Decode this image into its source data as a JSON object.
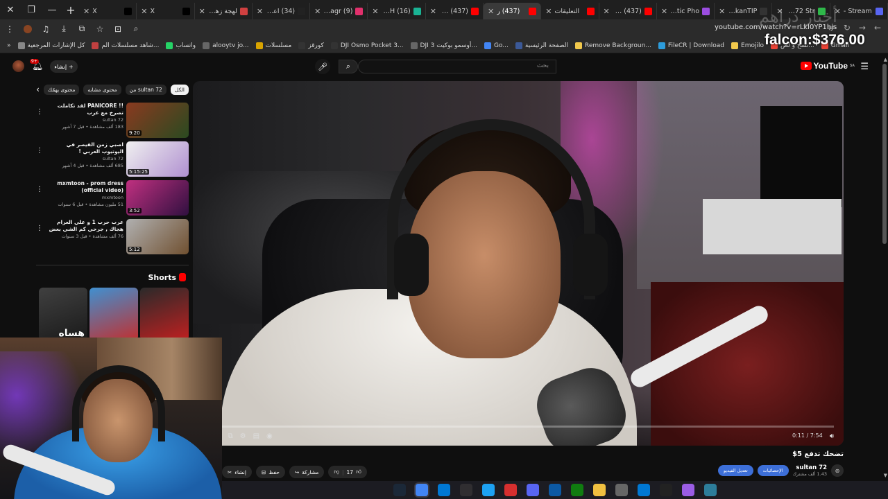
{
  "browser": {
    "tabs": [
      {
        "label": "X",
        "color": "#000000",
        "active": false
      },
      {
        "label": "X",
        "color": "#000000",
        "active": false
      },
      {
        "label": "لهجة زهران",
        "color": "#d04040",
        "active": false
      },
      {
        "label": "(34) اعلام",
        "color": "#222222",
        "active": false
      },
      {
        "label": "(9) Instagr",
        "color": "#e1306c",
        "active": false
      },
      {
        "label": "(16) Tip H",
        "color": "#1ab394",
        "active": false
      },
      {
        "label": "(437) فورت",
        "color": "#ff0000",
        "active": false
      },
      {
        "label": "(437) ر",
        "color": "#ff0000",
        "active": true
      },
      {
        "label": "التعليقات",
        "color": "#ff0000",
        "active": false
      },
      {
        "label": "(437) عراق",
        "color": "#ff0000",
        "active": false
      },
      {
        "label": "Gartic Pho",
        "color": "#9b4de0",
        "active": false
      },
      {
        "label": "DokanTIP",
        "color": "#333333",
        "active": false
      },
      {
        "label": "SLN72 Str",
        "color": "#2fb84a",
        "active": false
      },
      {
        "label": "Stream -",
        "color": "#5865f2",
        "active": false
      }
    ],
    "url": "youtube.com/watch?v=rLkl0YP1hjs",
    "bookmarks": [
      {
        "label": "كل الإشارات المرجعية",
        "color": "#888888"
      },
      {
        "label": "شاهد مسلسلات الم...",
        "color": "#c04040"
      },
      {
        "label": "واتساب",
        "color": "#25d366"
      },
      {
        "label": "alooytv jo...",
        "color": "#666666"
      },
      {
        "label": "مسلسلات",
        "color": "#d9a400"
      },
      {
        "label": "كورقز",
        "color": "#333333"
      },
      {
        "label": "DJI Osmo Pocket 3...",
        "color": "#333333"
      },
      {
        "label": "DJI أوسمو بوكيت 3...",
        "color": "#666666"
      },
      {
        "label": "Go...",
        "color": "#4285f4"
      },
      {
        "label": "الصفحة الرئيسية",
        "color": "#3b5998"
      },
      {
        "label": "Remove Backgroun...",
        "color": "#f2c94c"
      },
      {
        "label": "FileCR | Download",
        "color": "#2d9cdb"
      },
      {
        "label": "Emojilo",
        "color": "#f2c94c"
      },
      {
        "label": "نسخ و لص...",
        "color": "#ea4335"
      },
      {
        "label": "Gmail",
        "color": "#ea4335"
      }
    ]
  },
  "overlay": {
    "watermark": "أخبار دراهم",
    "falcon": "falcon:$376.00"
  },
  "youtube": {
    "logo": "YouTube",
    "logo_sup": "SA",
    "search_placeholder": "بحث",
    "create_label": "إنشاء",
    "notif_count": "9+",
    "chips": [
      "الكل",
      "من sultan 72",
      "محتوى مشابه",
      "محتوى يهمّك"
    ],
    "recommended": [
      {
        "title": "!! PANICORE لقد تكاملت تصرخ مع عرب",
        "channel": "sultan 72",
        "meta": "183 ألف مشاهدة • قبل 7 أشهر",
        "duration": "9:20",
        "c1": "#8a3a20",
        "c2": "#2a4a20"
      },
      {
        "title": "اصبي زمن القيصر في اليوتيوب العربي !",
        "channel": "sultan 72",
        "meta": "685 ألف مشاهدة • قبل 4 أشهر",
        "duration": "5:15:25",
        "c1": "#f0f0f0",
        "c2": "#b090d0"
      },
      {
        "title": "mxmtoon - prom dress (official video)",
        "channel": "mxmtoon",
        "meta": "51 مليون مشاهدة • قبل 6 سنوات",
        "duration": "3:52",
        "c1": "#c03080",
        "c2": "#301040"
      },
      {
        "title": "عرب حرب 1 و علي العرام هجاك , جرحي كم الشي بعض | امشي روح طبيي [FM]",
        "channel": "",
        "meta": "76 ألف مشاهدة • قبل 3 سنوات",
        "duration": "5:12",
        "c1": "#b0b0b0",
        "c2": "#705030"
      }
    ],
    "shorts_title": "Shorts",
    "shorts": [
      {
        "c1": "#404040",
        "c2": "#1a1a1a",
        "text": "هساه"
      },
      {
        "c1": "#4090d0",
        "c2": "#c03030",
        "text": ""
      },
      {
        "c1": "#2a2a2a",
        "c2": "#c02020",
        "text": ""
      }
    ],
    "player": {
      "time": "0:11 / 7:54",
      "progress": 0.023
    },
    "video_title": "تضحك تدفع 5$",
    "channel_name": "sultan 72",
    "channel_subs": "1.43 ألف مشترك",
    "subscribe_label": "الإحصائيات",
    "edit_label": "تعديل الفيديو",
    "likes": "17",
    "actions": [
      "مشاركة",
      "حفظ",
      "إنشاء"
    ]
  },
  "taskbar": {
    "icons": [
      {
        "name": "steam",
        "color": "#1b2838"
      },
      {
        "name": "chrome",
        "color": "#4285f4",
        "active": true
      },
      {
        "name": "store",
        "color": "#0078d4"
      },
      {
        "name": "obs",
        "color": "#302e31"
      },
      {
        "name": "app-teal",
        "color": "#1da1f2"
      },
      {
        "name": "app-red",
        "color": "#d62f2f"
      },
      {
        "name": "discord",
        "color": "#5865f2"
      },
      {
        "name": "edge",
        "color": "#0c59a4"
      },
      {
        "name": "xbox",
        "color": "#107c10"
      },
      {
        "name": "explorer",
        "color": "#f0c040"
      },
      {
        "name": "settings",
        "color": "#666666"
      },
      {
        "name": "outlook",
        "color": "#0078d4"
      },
      {
        "name": "capcut",
        "color": "#222222"
      },
      {
        "name": "copilot",
        "color": "#9b5de5"
      },
      {
        "name": "bing",
        "color": "#2d7d9a"
      }
    ]
  }
}
